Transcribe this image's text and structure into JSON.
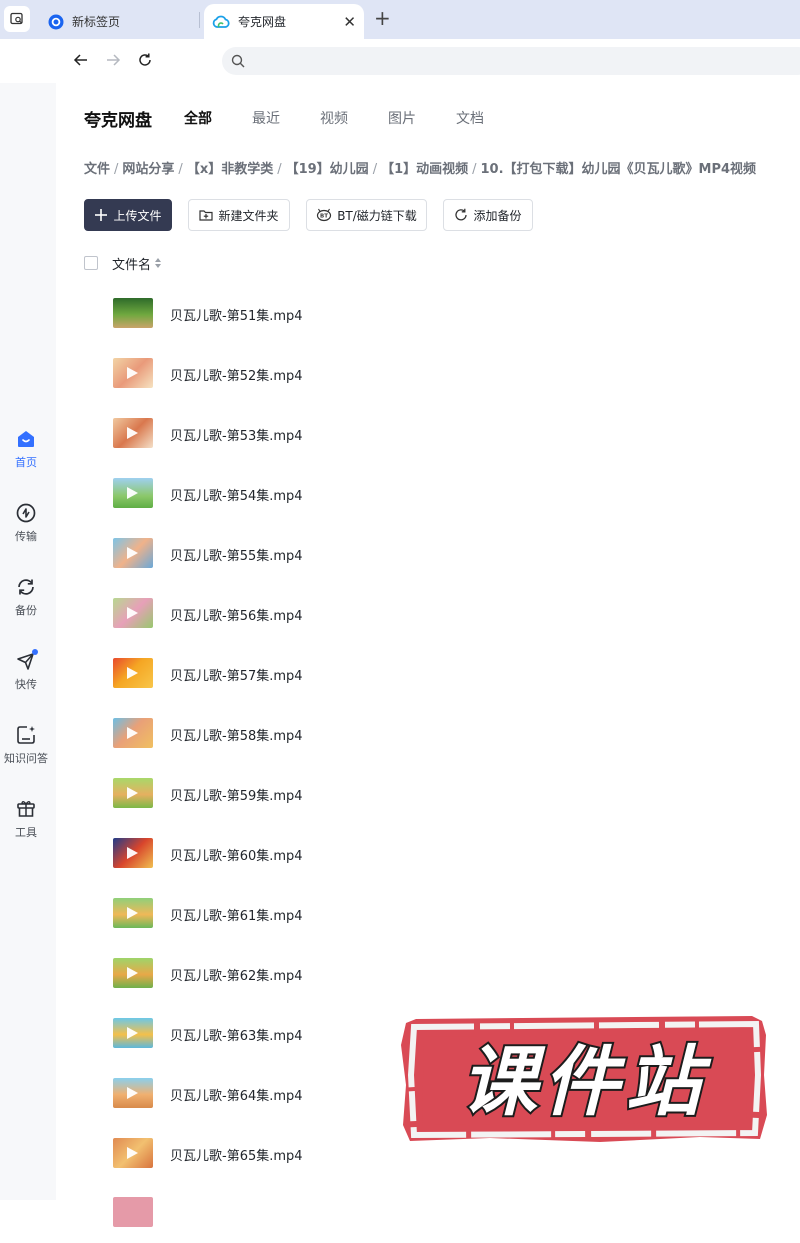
{
  "browser": {
    "tabs": [
      {
        "title": "新标签页",
        "active": false
      },
      {
        "title": "夸克网盘",
        "active": true
      }
    ],
    "new_tab_label": "+",
    "close_label": "✕"
  },
  "rail": [
    {
      "label": "首页",
      "icon": "home-icon",
      "active": true
    },
    {
      "label": "传输",
      "icon": "transfer-icon",
      "active": false
    },
    {
      "label": "备份",
      "icon": "backup-icon",
      "active": false
    },
    {
      "label": "快传",
      "icon": "send-icon",
      "active": false,
      "badge": true
    },
    {
      "label": "知识问答",
      "icon": "qa-icon",
      "active": false
    },
    {
      "label": "工具",
      "icon": "toolbox-icon",
      "active": false
    }
  ],
  "header": {
    "brand": "夸克网盘",
    "tabs": [
      "全部",
      "最近",
      "视频",
      "图片",
      "文档"
    ]
  },
  "breadcrumb": [
    "文件",
    "网站分享",
    "【x】非教学类",
    "【19】幼儿园",
    "【1】动画视频",
    "10.【打包下载】幼儿园《贝瓦儿歌》MP4视频"
  ],
  "actions": {
    "upload": "上传文件",
    "new_folder": "新建文件夹",
    "bt": "BT/磁力链下载",
    "backup": "添加备份"
  },
  "list": {
    "header": "文件名",
    "files": [
      "贝瓦儿歌-第51集.mp4",
      "贝瓦儿歌-第52集.mp4",
      "贝瓦儿歌-第53集.mp4",
      "贝瓦儿歌-第54集.mp4",
      "贝瓦儿歌-第55集.mp4",
      "贝瓦儿歌-第56集.mp4",
      "贝瓦儿歌-第57集.mp4",
      "贝瓦儿歌-第58集.mp4",
      "贝瓦儿歌-第59集.mp4",
      "贝瓦儿歌-第60集.mp4",
      "贝瓦儿歌-第61集.mp4",
      "贝瓦儿歌-第62集.mp4",
      "贝瓦儿歌-第63集.mp4",
      "贝瓦儿歌-第64集.mp4",
      "贝瓦儿歌-第65集.mp4"
    ]
  },
  "watermark": "课件站",
  "colors": {
    "accent": "#3370ff",
    "primary_button": "#343a52",
    "stamp": "#d94a55"
  }
}
